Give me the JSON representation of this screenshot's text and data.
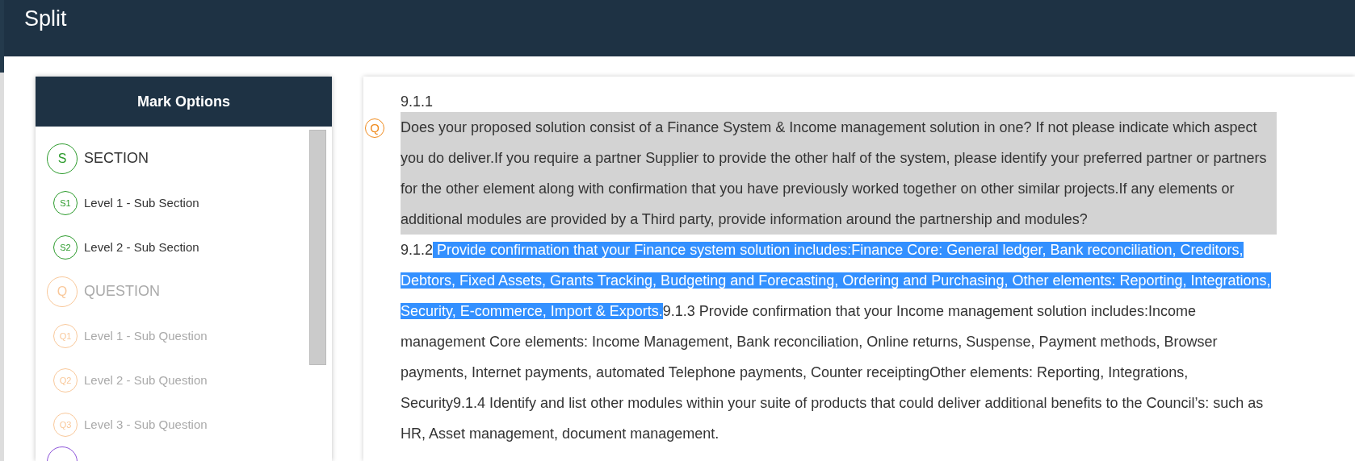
{
  "window": {
    "title": "Split"
  },
  "mark_options": {
    "title": "Mark Options",
    "items": [
      {
        "badge": "S",
        "label": "SECTION",
        "kind": "main",
        "color": "#2a9a2a",
        "disabled": false
      },
      {
        "badge": "S1",
        "label": "Level 1 - Sub Section",
        "kind": "sub",
        "color": "#2a9a2a",
        "disabled": false
      },
      {
        "badge": "S2",
        "label": "Level 2 - Sub Section",
        "kind": "sub",
        "color": "#2a9a2a",
        "disabled": false
      },
      {
        "badge": "Q",
        "label": "QUESTION",
        "kind": "main",
        "color": "#f9c89a",
        "disabled": true
      },
      {
        "badge": "Q1",
        "label": "Level 1 - Sub Question",
        "kind": "sub",
        "color": "#f9c89a",
        "disabled": true
      },
      {
        "badge": "Q2",
        "label": "Level 2 - Sub Question",
        "kind": "sub",
        "color": "#f9c89a",
        "disabled": true
      },
      {
        "badge": "Q3",
        "label": "Level 3 - Sub Question",
        "kind": "sub",
        "color": "#f9c89a",
        "disabled": true
      },
      {
        "kind": "cut",
        "color": "#8a4fd8"
      }
    ]
  },
  "document": {
    "number": "9.1.1",
    "marker": "Q",
    "question": "Does your proposed solution consist of a Finance System & Income management solution in one? If not please indicate which aspect you do deliver.If you require a partner Supplier to provide the other half of the system, please identify your preferred partner or partners for the other element along with confirmation that you have previously worked together on other similar projects.If any elements or additional modules are provided by a Third party, provide information around the partnership and modules?",
    "segments": [
      {
        "text": "9.1.2",
        "selected": false
      },
      {
        "text": " Provide confirmation that your Finance system solution includes:Finance Core: General ledger, Bank reconciliation, Creditors, Debtors, Fixed Assets, Grants Tracking, Budgeting and Forecasting, Ordering and Purchasing, Other elements: Reporting, Integrations, Security, E-commerce, Import & Exports.",
        "selected": true
      },
      {
        "text": "9.1.3 Provide confirmation that your Income management solution includes:Income management Core elements: Income Management, Bank reconciliation, Online returns, Suspense, Payment methods, Browser payments, Internet payments, automated Telephone payments, Counter receiptingOther elements: Reporting, Integrations, Security9.1.4 Identify and list other modules within your suite of products that could deliver additional benefits to the Council’s: such as HR, Asset management, document management.",
        "selected": false
      }
    ]
  }
}
